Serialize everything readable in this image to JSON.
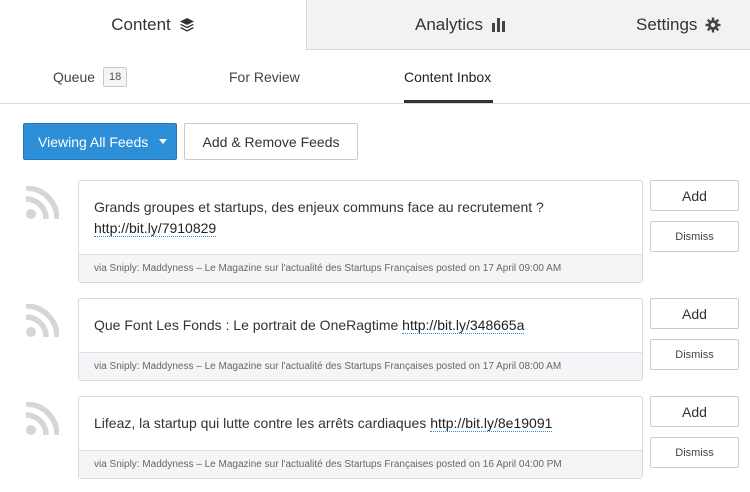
{
  "top_tabs": {
    "content": "Content",
    "analytics": "Analytics",
    "settings": "Settings"
  },
  "sub_tabs": {
    "queue": "Queue",
    "queue_count": "18",
    "for_review": "For Review",
    "content_inbox": "Content Inbox"
  },
  "toolbar": {
    "viewing_all_feeds": "Viewing All Feeds",
    "add_remove_feeds": "Add & Remove Feeds"
  },
  "feeds": [
    {
      "text": "Grands groupes et startups, des enjeux communs face au recrutement ?",
      "link": "http://bit.ly/7910829",
      "meta": "via Sniply: Maddyness – Le Magazine sur l'actualité des Startups Françaises posted on 17 April 09:00 AM",
      "add_label": "Add",
      "dismiss_label": "Dismiss"
    },
    {
      "text": "Que Font Les Fonds : Le portrait de OneRagtime",
      "link": "http://bit.ly/348665a",
      "meta": "via Sniply: Maddyness – Le Magazine sur l'actualité des Startups Françaises posted on 17 April 08:00 AM",
      "add_label": "Add",
      "dismiss_label": "Dismiss"
    },
    {
      "text": "Lifeaz, la startup qui lutte contre les arrêts cardiaques",
      "link": "http://bit.ly/8e19091",
      "meta": "via Sniply: Maddyness – Le Magazine sur l'actualité des Startups Françaises posted on 16 April 04:00 PM",
      "add_label": "Add",
      "dismiss_label": "Dismiss"
    }
  ],
  "icons": {
    "content": "layers-icon",
    "analytics": "bar-chart-icon",
    "settings": "gear-icon",
    "feed": "rss-icon",
    "dropdown": "caret-down-icon"
  },
  "colors": {
    "primary": "#2d8fd8",
    "tab_inactive_bg": "#f0f2f4",
    "border": "#d6dadf",
    "rss_icon": "#d4d6d9"
  }
}
